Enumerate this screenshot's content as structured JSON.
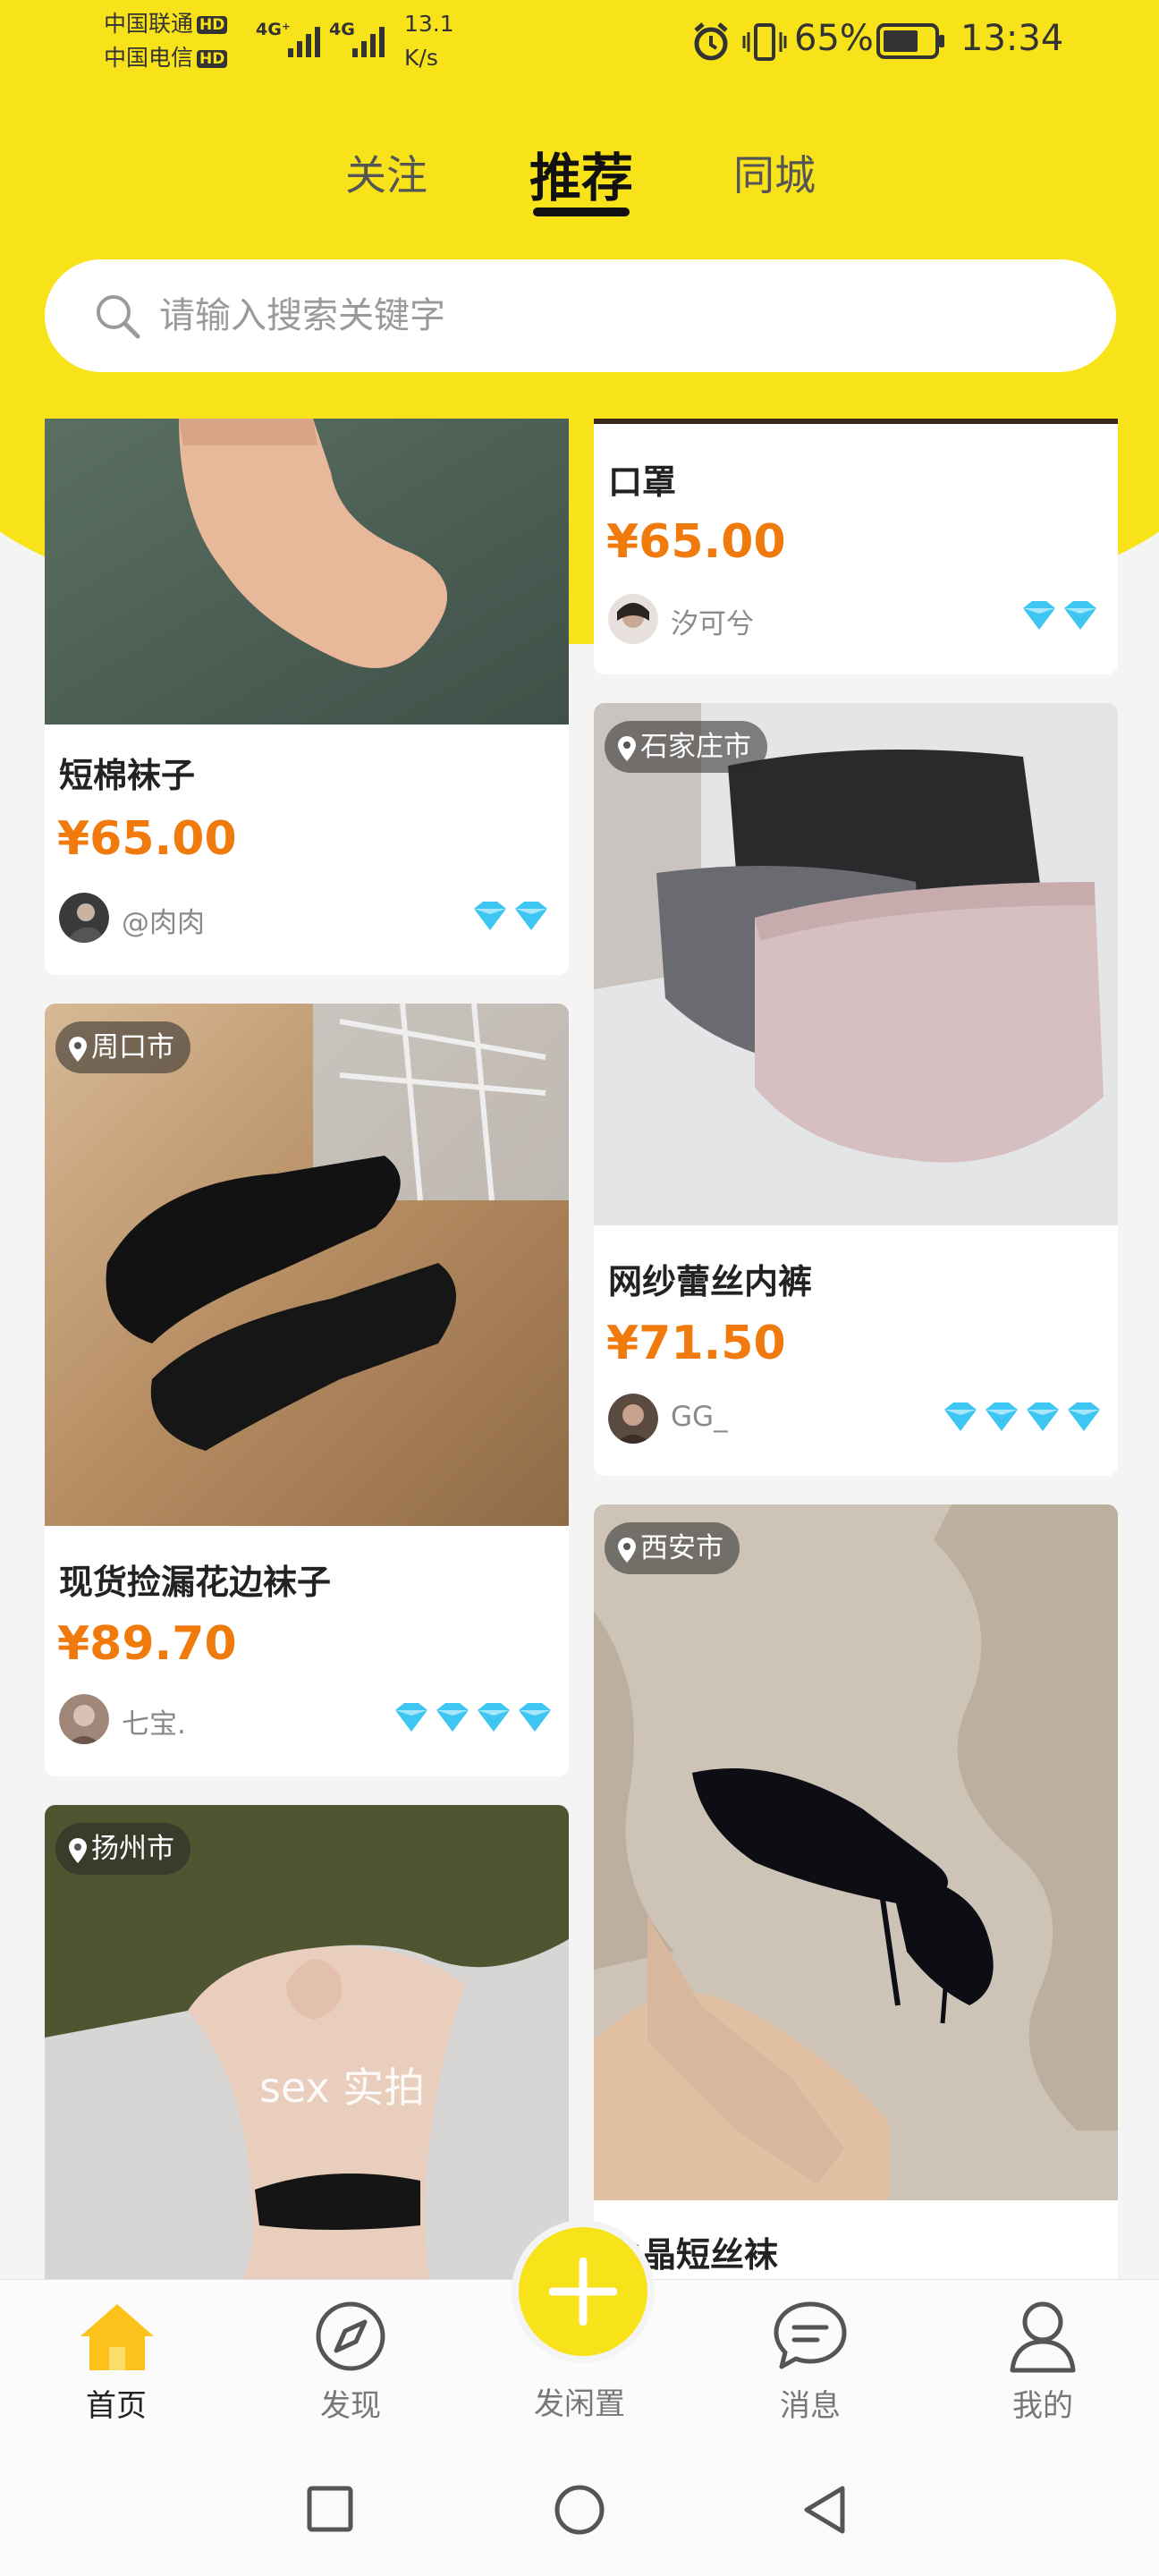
{
  "status_bar": {
    "carrier1": "中国联通",
    "carrier2": "中国电信",
    "hd": "HD",
    "net1": "4G⁺",
    "net2": "4G",
    "speed_value": "13.1",
    "speed_unit": "K/s",
    "battery": "65%",
    "time": "13:34"
  },
  "tabs": [
    "关注",
    "推荐",
    "同城"
  ],
  "active_tab": "推荐",
  "search": {
    "placeholder": "请输入搜索关键字"
  },
  "left_cards": [
    {
      "title": "短棉袜子",
      "price": "¥65.00",
      "user": "@肉肉",
      "gems": 2,
      "location": ""
    },
    {
      "title": "现货捡漏花边袜子",
      "price": "¥89.70",
      "user": "七宝.",
      "gems": 4,
      "location": "周口市"
    },
    {
      "title": "",
      "price": "",
      "user": "",
      "gems": 0,
      "location": "扬州市",
      "overlay": "sex 实拍"
    }
  ],
  "right_cards": [
    {
      "title": "口罩",
      "price": "¥65.00",
      "user": "汐可兮",
      "gems": 2,
      "location": ""
    },
    {
      "title": "网纱蕾丝内裤",
      "price": "¥71.50",
      "user": "GG_",
      "gems": 4,
      "location": "石家庄市"
    },
    {
      "title": "水晶短丝袜",
      "price": "",
      "user": "",
      "gems": 0,
      "location": "西安市"
    }
  ],
  "nav": [
    {
      "label": "首页",
      "icon": "home-icon",
      "active": true
    },
    {
      "label": "发现",
      "icon": "compass-icon",
      "active": false
    },
    {
      "label": "发闲置",
      "icon": "plus-icon",
      "active": false
    },
    {
      "label": "消息",
      "icon": "chat-icon",
      "active": false
    },
    {
      "label": "我的",
      "icon": "person-icon",
      "active": false
    }
  ],
  "colors": {
    "brand_yellow": "#f8e21a",
    "price_orange": "#f07a0c",
    "gem_blue": "#3ec6f2"
  }
}
